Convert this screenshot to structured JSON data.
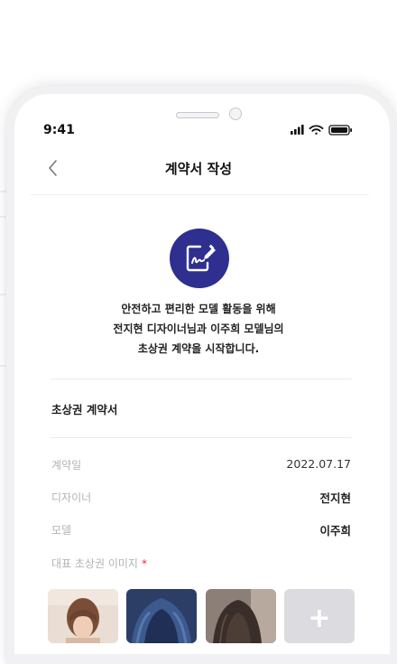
{
  "status_bar": {
    "time": "9:41"
  },
  "header": {
    "title": "계약서 작성",
    "back_icon": "chevron-left-icon"
  },
  "intro": {
    "icon": "contract-sign-icon",
    "lines": [
      "안전하고 편리한 모델 활동을 위해",
      "전지현 디자이너님과 이주희 모델님의",
      "초상권 계약을 시작합니다."
    ]
  },
  "contract": {
    "section_title": "초상권 계약서",
    "rows": [
      {
        "label": "계약일",
        "value": "2022.07.17"
      },
      {
        "label": "디자이너",
        "value": "전지현"
      },
      {
        "label": "모델",
        "value": "이주희"
      }
    ],
    "image_label": "대표 초상권 이미지",
    "required_mark": "*",
    "add_label": "+"
  },
  "colors": {
    "accent": "#2e2f8f",
    "required": "#e5283a"
  }
}
